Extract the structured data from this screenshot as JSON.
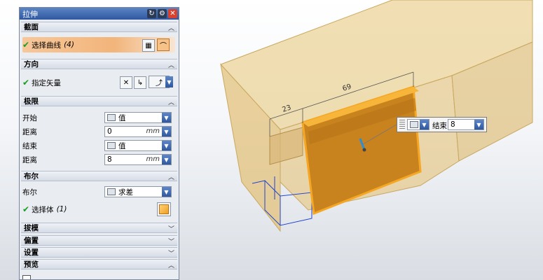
{
  "dialog": {
    "title": "拉伸",
    "sections": {
      "section": {
        "header": "截面",
        "select_curve_label": "选择曲线",
        "select_curve_count": "(4)"
      },
      "direction": {
        "header": "方向",
        "vector_label": "指定矢量"
      },
      "limits": {
        "header": "极限",
        "start_label": "开始",
        "start_mode": "值",
        "start_distance_label": "距离",
        "start_distance_value": "0",
        "end_label": "结束",
        "end_mode": "值",
        "end_distance_label": "距离",
        "end_distance_value": "8",
        "unit": "mm"
      },
      "boolean": {
        "header": "布尔",
        "boolean_label": "布尔",
        "boolean_value": "求差",
        "select_body_label": "选择体",
        "select_body_count": "(1)"
      },
      "draft": {
        "header": "拔模"
      },
      "offset": {
        "header": "偏置"
      },
      "settings": {
        "header": "设置"
      },
      "preview": {
        "header": "预览"
      }
    }
  },
  "viewport": {
    "dimension_left": "23",
    "dimension_top": "69",
    "float_input": {
      "label": "结束",
      "value": "8"
    }
  },
  "colors": {
    "title_bar": "#3a64ad",
    "selection_highlight": "#f2b57a",
    "model_transparent": "#e8c77a",
    "extrude_face": "#c8821e",
    "extrude_edge": "#f5a623"
  }
}
